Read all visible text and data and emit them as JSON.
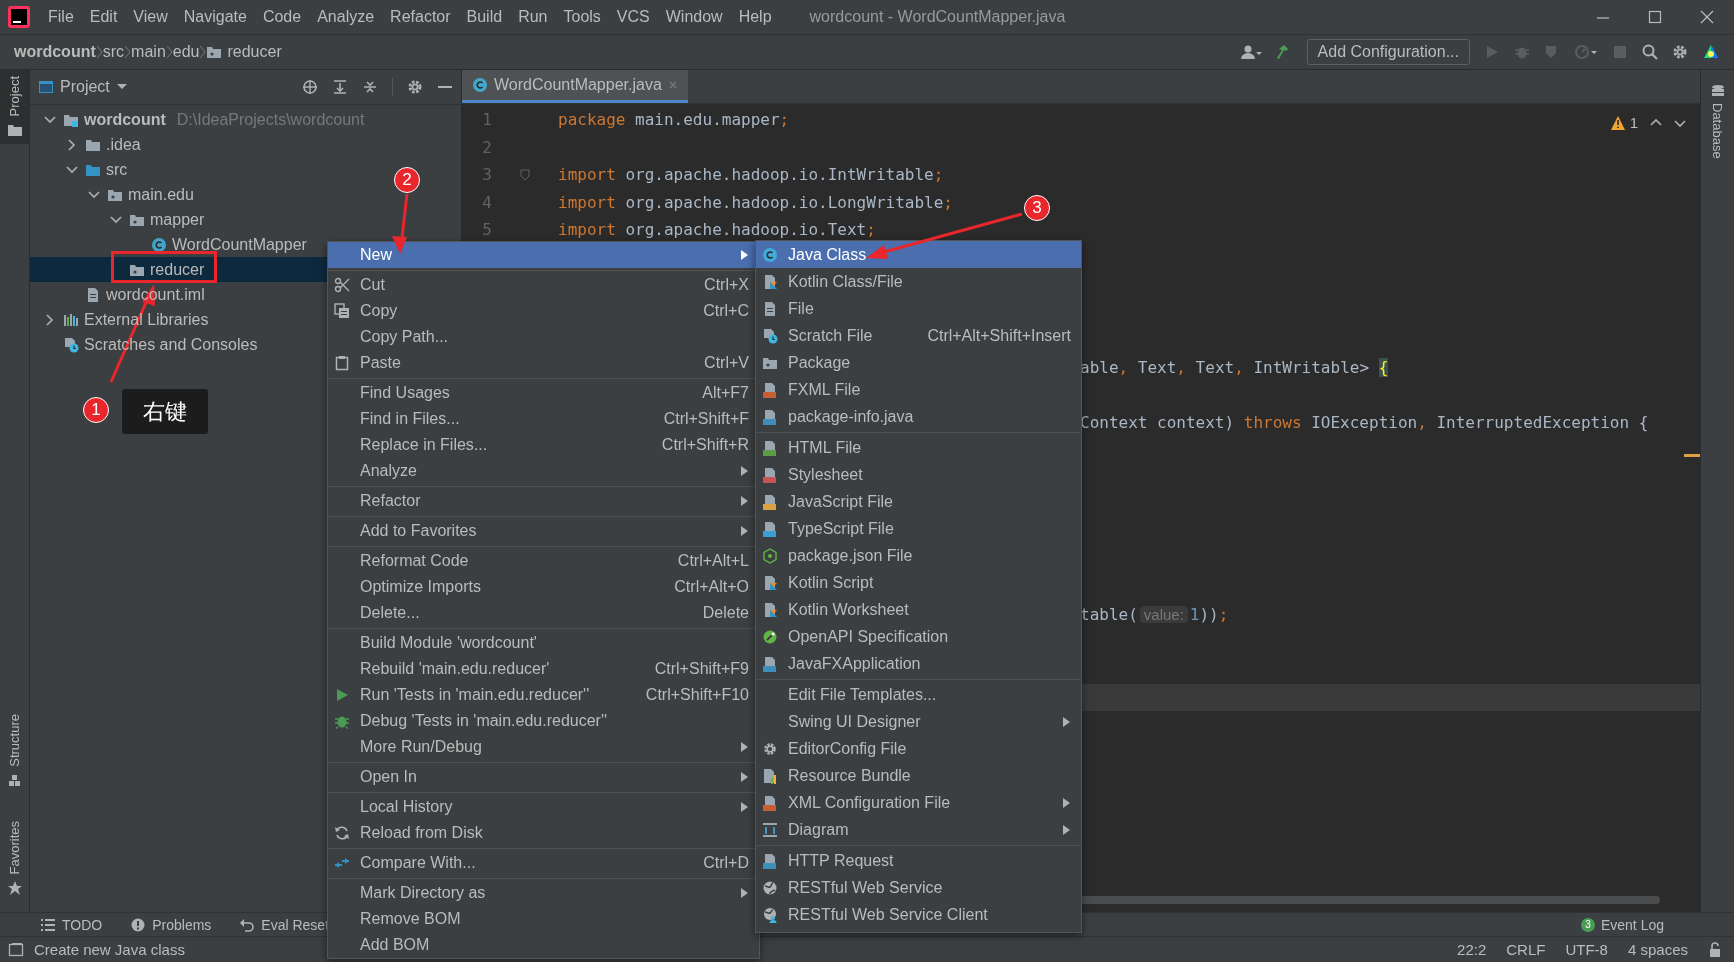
{
  "window": {
    "title": "wordcount - WordCountMapper.java"
  },
  "menu_bar": [
    "File",
    "Edit",
    "View",
    "Navigate",
    "Code",
    "Analyze",
    "Refactor",
    "Build",
    "Run",
    "Tools",
    "VCS",
    "Window",
    "Help"
  ],
  "breadcrumbs": [
    {
      "label": "wordcount",
      "kind": "project"
    },
    {
      "label": "src",
      "kind": "plain"
    },
    {
      "label": "main",
      "kind": "plain"
    },
    {
      "label": "edu",
      "kind": "plain"
    },
    {
      "label": "reducer",
      "kind": "package"
    }
  ],
  "toolbar": {
    "run_config": "Add Configuration..."
  },
  "left_stripe": [
    {
      "label": "Project",
      "selected": true
    },
    {
      "label": "Structure",
      "selected": false
    },
    {
      "label": "Favorites",
      "selected": false
    }
  ],
  "right_stripe": [
    {
      "label": "Database"
    }
  ],
  "project_panel": {
    "title": "Project",
    "tree": [
      {
        "label": "wordcount",
        "path": "D:\\IdeaProjects\\wordcount",
        "kind": "module",
        "expanded": true,
        "selected": false,
        "children": [
          {
            "label": ".idea",
            "kind": "folder",
            "expanded": false,
            "selected": false
          },
          {
            "label": "src",
            "kind": "source-folder",
            "expanded": true,
            "selected": false,
            "children": [
              {
                "label": "main.edu",
                "kind": "package",
                "expanded": true,
                "selected": false,
                "children": [
                  {
                    "label": "mapper",
                    "kind": "package",
                    "expanded": true,
                    "selected": false,
                    "children": [
                      {
                        "label": "WordCountMapper",
                        "kind": "class",
                        "selected": false
                      }
                    ]
                  },
                  {
                    "label": "reducer",
                    "kind": "package",
                    "selected": true
                  }
                ]
              }
            ]
          },
          {
            "label": "wordcount.iml",
            "kind": "iml",
            "selected": false
          }
        ]
      },
      {
        "label": "External Libraries",
        "kind": "libraries",
        "expanded": false,
        "selected": false
      },
      {
        "label": "Scratches and Consoles",
        "kind": "scratches",
        "selected": false
      }
    ]
  },
  "editor": {
    "tab": {
      "label": "WordCountMapper.java",
      "selected": true
    },
    "warnings": "1",
    "lines": [
      {
        "number": "1",
        "segments": [
          {
            "kind": "keyword",
            "text": "package"
          },
          {
            "kind": "plain",
            "text": " main.edu.mapper"
          },
          {
            "kind": "punct",
            "text": ";"
          }
        ]
      },
      {
        "number": "2"
      },
      {
        "number": "3",
        "fold": true,
        "segments": [
          {
            "kind": "keyword",
            "text": "import"
          },
          {
            "kind": "plain",
            "text": " org.apache.hadoop.io.IntWritable"
          },
          {
            "kind": "punct",
            "text": ";"
          }
        ]
      },
      {
        "number": "4",
        "segments": [
          {
            "kind": "keyword",
            "text": "import"
          },
          {
            "kind": "plain",
            "text": " org.apache.hadoop.io.LongWritable"
          },
          {
            "kind": "punct",
            "text": ";"
          }
        ]
      },
      {
        "number": "5",
        "segments": [
          {
            "kind": "keyword",
            "text": "import"
          },
          {
            "kind": "plain",
            "text": " org.apache.hadoop.io.Text"
          },
          {
            "kind": "punct",
            "text": ";"
          }
        ]
      },
      {
        "segments": [
          {
            "kind": "plain",
            "text": "able"
          },
          {
            "kind": "punct",
            "text": ","
          },
          {
            "kind": "plain",
            "text": " Text"
          },
          {
            "kind": "punct",
            "text": ","
          },
          {
            "kind": "plain",
            "text": " Text"
          },
          {
            "kind": "punct",
            "text": ","
          },
          {
            "kind": "plain",
            "text": " IntWritable> "
          },
          {
            "kind": "brace",
            "text": "{"
          }
        ]
      },
      {
        "segments": [
          {
            "kind": "plain",
            "text": "Context context) "
          },
          {
            "kind": "keyword",
            "text": "throws"
          },
          {
            "kind": "plain",
            "text": " IOException"
          },
          {
            "kind": "punct",
            "text": ","
          },
          {
            "kind": "plain",
            "text": " InterruptedException {"
          }
        ]
      },
      {
        "segments": [
          {
            "kind": "plain",
            "text": "table("
          },
          {
            "kind": "hint",
            "text": "value:"
          },
          {
            "kind": "number",
            "text": "1"
          },
          {
            "kind": "plain",
            "text": "))"
          },
          {
            "kind": "punct",
            "text": ";"
          }
        ]
      },
      {
        "current": true
      }
    ]
  },
  "context_menu": [
    {
      "kind": "plain",
      "label": "New",
      "selected": true,
      "submenu": true
    },
    {
      "kind": "separator"
    },
    {
      "kind": "scissors",
      "label": "Cut",
      "shortcut": "Ctrl+X",
      "selected": false,
      "submenu": false
    },
    {
      "kind": "copy",
      "label": "Copy",
      "shortcut": "Ctrl+C",
      "selected": false,
      "submenu": false
    },
    {
      "kind": "plain",
      "label": "Copy Path...",
      "selected": false,
      "submenu": false
    },
    {
      "kind": "paste",
      "label": "Paste",
      "shortcut": "Ctrl+V",
      "selected": false,
      "submenu": false
    },
    {
      "kind": "separator"
    },
    {
      "kind": "plain",
      "label": "Find Usages",
      "shortcut": "Alt+F7",
      "selected": false,
      "submenu": false
    },
    {
      "kind": "plain",
      "label": "Find in Files...",
      "shortcut": "Ctrl+Shift+F",
      "selected": false,
      "submenu": false
    },
    {
      "kind": "plain",
      "label": "Replace in Files...",
      "shortcut": "Ctrl+Shift+R",
      "selected": false,
      "submenu": false
    },
    {
      "kind": "plain",
      "label": "Analyze",
      "selected": false,
      "submenu": true
    },
    {
      "kind": "separator"
    },
    {
      "kind": "plain",
      "label": "Refactor",
      "selected": false,
      "submenu": true
    },
    {
      "kind": "separator"
    },
    {
      "kind": "plain",
      "label": "Add to Favorites",
      "selected": false,
      "submenu": true
    },
    {
      "kind": "separator"
    },
    {
      "kind": "plain",
      "label": "Reformat Code",
      "shortcut": "Ctrl+Alt+L",
      "selected": false,
      "submenu": false
    },
    {
      "kind": "plain",
      "label": "Optimize Imports",
      "shortcut": "Ctrl+Alt+O",
      "selected": false,
      "submenu": false
    },
    {
      "kind": "plain",
      "label": "Delete...",
      "shortcut": "Delete",
      "selected": false,
      "submenu": false
    },
    {
      "kind": "separator"
    },
    {
      "kind": "plain",
      "label": "Build Module 'wordcount'",
      "selected": false,
      "submenu": false
    },
    {
      "kind": "plain",
      "label": "Rebuild 'main.edu.reducer'",
      "shortcut": "Ctrl+Shift+F9",
      "selected": false,
      "submenu": false
    },
    {
      "kind": "run",
      "label": "Run 'Tests in 'main.edu.reducer''",
      "shortcut": "Ctrl+Shift+F10",
      "selected": false,
      "submenu": false
    },
    {
      "kind": "debug",
      "label": "Debug 'Tests in 'main.edu.reducer''",
      "selected": false,
      "submenu": false
    },
    {
      "kind": "plain",
      "label": "More Run/Debug",
      "selected": false,
      "submenu": true
    },
    {
      "kind": "separator"
    },
    {
      "kind": "plain",
      "label": "Open In",
      "selected": false,
      "submenu": true
    },
    {
      "kind": "separator"
    },
    {
      "kind": "plain",
      "label": "Local History",
      "selected": false,
      "submenu": true
    },
    {
      "kind": "reload",
      "label": "Reload from Disk",
      "selected": false,
      "submenu": false
    },
    {
      "kind": "separator"
    },
    {
      "kind": "compare",
      "label": "Compare With...",
      "shortcut": "Ctrl+D",
      "selected": false,
      "submenu": false
    },
    {
      "kind": "separator"
    },
    {
      "kind": "plain",
      "label": "Mark Directory as",
      "selected": false,
      "submenu": true
    },
    {
      "kind": "plain",
      "label": "Remove BOM",
      "selected": false,
      "submenu": false
    },
    {
      "kind": "plain",
      "label": "Add BOM",
      "selected": false,
      "submenu": false
    }
  ],
  "new_submenu": [
    {
      "kind": "class",
      "label": "Java Class",
      "selected": true,
      "submenu": false
    },
    {
      "kind": "kotlin",
      "label": "Kotlin Class/File",
      "selected": false,
      "submenu": false
    },
    {
      "kind": "file",
      "label": "File",
      "selected": false,
      "submenu": false
    },
    {
      "kind": "scratch",
      "label": "Scratch File",
      "shortcut": "Ctrl+Alt+Shift+Insert",
      "selected": false,
      "submenu": false
    },
    {
      "kind": "package",
      "label": "Package",
      "selected": false,
      "submenu": false
    },
    {
      "kind": "tagged-file",
      "label": "FXML File",
      "color": "#c75f35",
      "selected": false,
      "submenu": false
    },
    {
      "kind": "tagged-file",
      "label": "package-info.java",
      "color": "#3d8eb9",
      "selected": false,
      "submenu": false
    },
    {
      "kind": "separator"
    },
    {
      "kind": "tagged-file",
      "label": "HTML File",
      "color": "#5d9b47",
      "selected": false,
      "submenu": false
    },
    {
      "kind": "tagged-file",
      "label": "Stylesheet",
      "color": "#c75450",
      "selected": false,
      "submenu": false
    },
    {
      "kind": "tagged-file",
      "label": "JavaScript File",
      "color": "#d9a343",
      "selected": false,
      "submenu": false
    },
    {
      "kind": "tagged-file",
      "label": "TypeScript File",
      "color": "#389fd6",
      "selected": false,
      "submenu": false
    },
    {
      "kind": "hexagon",
      "label": "package.json File",
      "selected": false,
      "submenu": false
    },
    {
      "kind": "kotlin",
      "label": "Kotlin Script",
      "selected": false,
      "submenu": false
    },
    {
      "kind": "kotlin",
      "label": "Kotlin Worksheet",
      "selected": false,
      "submenu": false
    },
    {
      "kind": "openapi",
      "label": "OpenAPI Specification",
      "selected": false,
      "submenu": false
    },
    {
      "kind": "tagged-file",
      "label": "JavaFXApplication",
      "color": "#3d8eb9",
      "selected": false,
      "submenu": false
    },
    {
      "kind": "separator"
    },
    {
      "kind": "plain",
      "label": "Edit File Templates...",
      "selected": false,
      "submenu": false
    },
    {
      "kind": "plain",
      "label": "Swing UI Designer",
      "selected": false,
      "submenu": true
    },
    {
      "kind": "gear",
      "label": "EditorConfig File",
      "selected": false,
      "submenu": false
    },
    {
      "kind": "bundle",
      "label": "Resource Bundle",
      "selected": false,
      "submenu": false
    },
    {
      "kind": "tagged-file",
      "label": "XML Configuration File",
      "color": "#c75f35",
      "selected": false,
      "submenu": true
    },
    {
      "kind": "diagram",
      "label": "Diagram",
      "selected": false,
      "submenu": true
    },
    {
      "kind": "separator"
    },
    {
      "kind": "tagged-file",
      "label": "HTTP Request",
      "color": "#3d8eb9",
      "selected": false,
      "submenu": false
    },
    {
      "kind": "globe",
      "label": "RESTful Web Service",
      "selected": false,
      "submenu": false
    },
    {
      "kind": "globe-user",
      "label": "RESTful Web Service Client",
      "selected": false,
      "submenu": false
    }
  ],
  "tool_windows": [
    {
      "label": "TODO",
      "kind": "list"
    },
    {
      "label": "Problems",
      "kind": "info"
    },
    {
      "label": "Eval Reset",
      "kind": "undo"
    }
  ],
  "event_log": {
    "label": "Event Log",
    "count": "3"
  },
  "status_bar": {
    "message": "Create new Java class",
    "position": "22:2",
    "line_separator": "CRLF",
    "encoding": "UTF-8",
    "indent": "4 spaces"
  },
  "annotations": {
    "markers": [
      {
        "number": "1"
      },
      {
        "number": "2"
      },
      {
        "number": "3"
      }
    ],
    "label": "右键"
  }
}
